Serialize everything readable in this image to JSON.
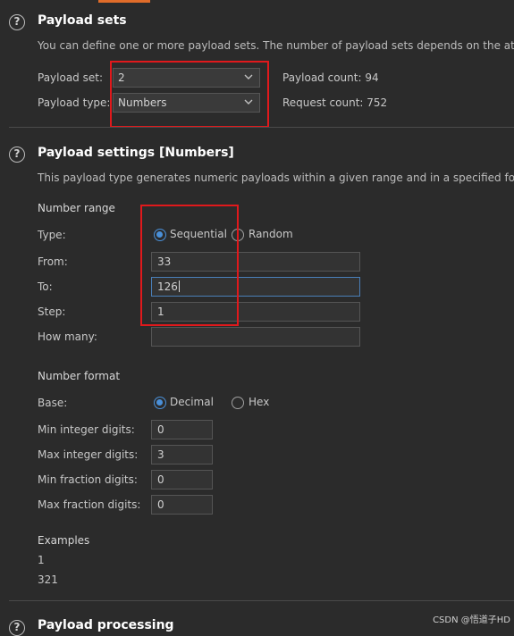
{
  "payload_sets": {
    "title": "Payload sets",
    "description": "You can define one or more payload sets. The number of payload sets depends on the atta",
    "set_label": "Payload set:",
    "set_value": "2",
    "type_label": "Payload type:",
    "type_value": "Numbers",
    "count_text": "Payload count: 94",
    "request_text": "Request count: 752"
  },
  "payload_settings": {
    "title": "Payload settings [Numbers]",
    "description": "This payload type generates numeric payloads within a given range and in a specified form",
    "number_range": {
      "heading": "Number range",
      "type_label": "Type:",
      "sequential_label": "Sequential",
      "random_label": "Random",
      "from_label": "From:",
      "from_value": "33",
      "to_label": "To:",
      "to_value": "126",
      "step_label": "Step:",
      "step_value": "1",
      "how_many_label": "How many:",
      "how_many_value": ""
    },
    "number_format": {
      "heading": "Number format",
      "base_label": "Base:",
      "decimal_label": "Decimal",
      "hex_label": "Hex",
      "min_int_label": "Min integer digits:",
      "min_int_value": "0",
      "max_int_label": "Max integer digits:",
      "max_int_value": "3",
      "min_frac_label": "Min fraction digits:",
      "min_frac_value": "0",
      "max_frac_label": "Max fraction digits:",
      "max_frac_value": "0"
    },
    "examples": {
      "heading": "Examples",
      "items": [
        "1",
        "321"
      ]
    }
  },
  "payload_processing": {
    "title": "Payload processing"
  },
  "help_glyph": "?",
  "watermark": "CSDN @悟道子HD"
}
